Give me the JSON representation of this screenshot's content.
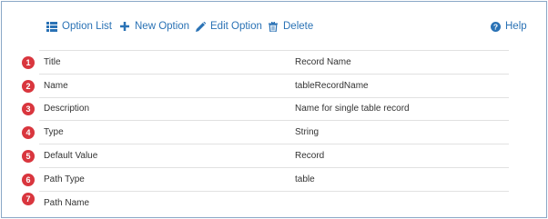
{
  "toolbar": {
    "option_list": "Option List",
    "new_option": "New Option",
    "edit_option": "Edit Option",
    "delete": "Delete",
    "help": "Help"
  },
  "colors": {
    "link": "#2a72b5",
    "badge": "#d9363e",
    "border": "#8aa8c7"
  },
  "rows": [
    {
      "badge": "1",
      "name": "Title",
      "value": "Record Name"
    },
    {
      "badge": "2",
      "name": "Name",
      "value": "tableRecordName"
    },
    {
      "badge": "3",
      "name": "Description",
      "value": "Name for single table record"
    },
    {
      "badge": "4",
      "name": "Type",
      "value": "String"
    },
    {
      "badge": "5",
      "name": "Default Value",
      "value": "Record"
    },
    {
      "badge": "6",
      "name": "Path Type",
      "value": "table"
    },
    {
      "badge": "7",
      "name": "Path Name",
      "value": ""
    }
  ]
}
